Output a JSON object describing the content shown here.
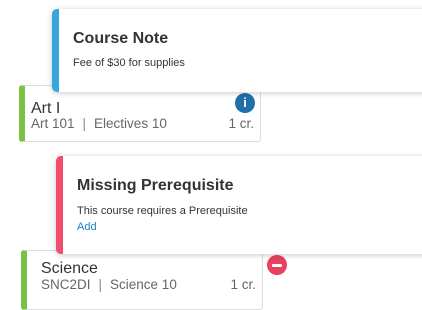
{
  "course_note": {
    "title": "Course Note",
    "body": "Fee of $30 for supplies"
  },
  "art_course": {
    "title": "Art I",
    "code": "Art 101",
    "separator": "|",
    "category": "Electives 10",
    "credits": "1 cr.",
    "status_icon": "info-icon"
  },
  "missing_prereq": {
    "title": "Missing Prerequisite",
    "body": "This course requires a Prerequisite",
    "link": "Add"
  },
  "science_course": {
    "title": "Science",
    "code": "SNC2DI",
    "separator": "|",
    "category": "Science 10",
    "credits": "1 cr.",
    "status_icon": "blocked-icon"
  },
  "colors": {
    "course_accent": "#7cc242",
    "note_accent": "#35a7de",
    "prereq_accent": "#f14b6e",
    "info_icon": "#1f6fa8",
    "blocked_icon": "#e8405e",
    "link": "#1e7fc2"
  }
}
